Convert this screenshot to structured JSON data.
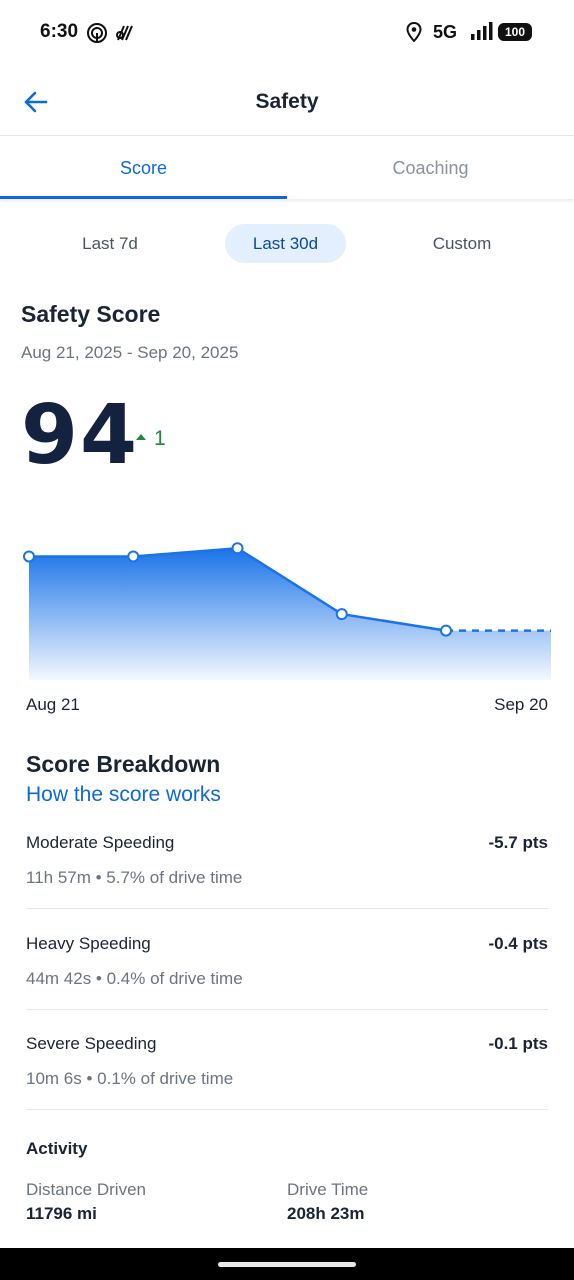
{
  "status": {
    "time": "6:30",
    "network": "5G",
    "battery": "100"
  },
  "header": {
    "title": "Safety"
  },
  "tabs": [
    {
      "label": "Score",
      "selected": true
    },
    {
      "label": "Coaching",
      "selected": false
    }
  ],
  "periods": [
    {
      "label": "Last 7d",
      "selected": false
    },
    {
      "label": "Last 30d",
      "selected": true
    },
    {
      "label": "Custom",
      "selected": false
    }
  ],
  "safety_score": {
    "title": "Safety Score",
    "date_range": "Aug 21, 2025 - Sep 20, 2025",
    "score": "94",
    "delta": "1"
  },
  "chart_data": {
    "type": "area",
    "x_start_label": "Aug 21",
    "x_end_label": "Sep 20",
    "values": [
      95.0,
      95.0,
      96.0,
      88.0,
      86.0
    ],
    "projected_last": 86.0,
    "ylim": [
      80,
      97
    ],
    "color": "#1a73e8"
  },
  "breakdown": {
    "title": "Score Breakdown",
    "link": "How the score works",
    "items": [
      {
        "name": "Moderate Speeding",
        "points": "-5.7 pts",
        "detail": "11h 57m • 5.7% of drive time"
      },
      {
        "name": "Heavy Speeding",
        "points": "-0.4 pts",
        "detail": "44m 42s • 0.4% of drive time"
      },
      {
        "name": "Severe Speeding",
        "points": "-0.1 pts",
        "detail": "10m 6s • 0.1% of drive time"
      }
    ]
  },
  "activity": {
    "title": "Activity",
    "distance_label": "Distance Driven",
    "distance_value": "11796 mi",
    "time_label": "Drive Time",
    "time_value": "208h 23m"
  },
  "colors": {
    "accent": "#0c6ad6",
    "positive": "#1a8a3d",
    "text": "#1a2435"
  }
}
